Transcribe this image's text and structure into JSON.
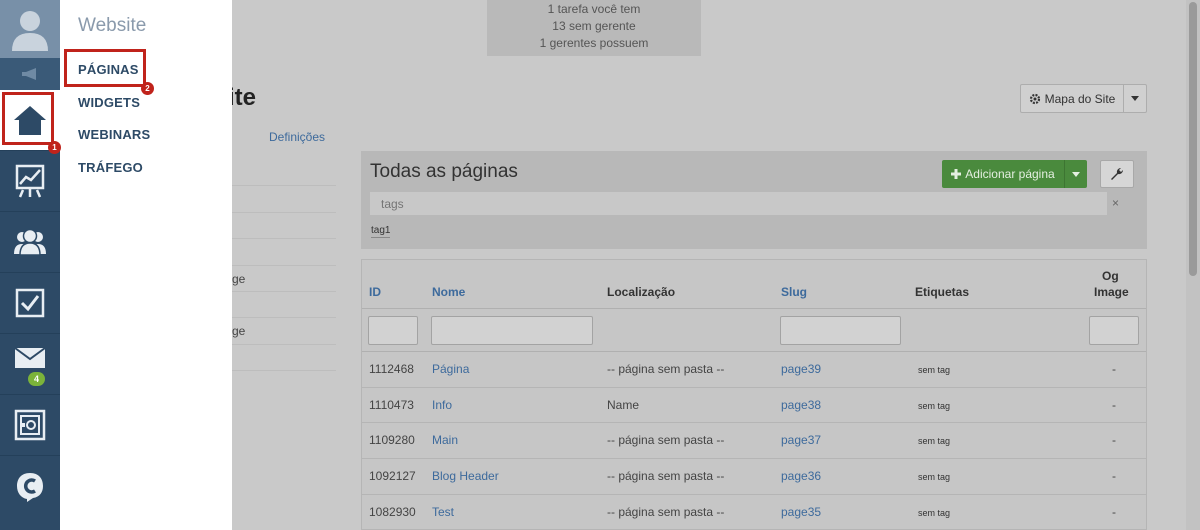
{
  "rail": {
    "badge_mail": "4",
    "annotation_1": "1",
    "annotation_2": "2"
  },
  "flyout": {
    "title": "Website",
    "items": [
      "PÁGINAS",
      "WIDGETS",
      "WEBINARS",
      "TRÁFEGO"
    ]
  },
  "notice": {
    "line1": "1 tarefa você tem",
    "line2": "13 sem gerente",
    "line3": "1 gerentes possuem"
  },
  "page": {
    "title_fragment": "ite",
    "tab_definitions": "Definições",
    "sitemap_label": "Mapa do Site"
  },
  "leftlist": [
    "",
    "",
    "",
    "",
    "ge",
    "",
    "ge",
    ""
  ],
  "panel": {
    "title": "Todas as páginas",
    "add_label": "Adicionar página",
    "tags_placeholder": "tags",
    "tags_clear": "×",
    "tag_chip": "tag1"
  },
  "table": {
    "headers": {
      "id": "ID",
      "name": "Nome",
      "location": "Localização",
      "slug": "Slug",
      "tags": "Etiquetas",
      "og1": "Og",
      "og2": "Image"
    },
    "rows": [
      {
        "id": "1112468",
        "name": "Página",
        "location": "-- página sem pasta --",
        "slug": "page39",
        "tags": "sem tag",
        "og": "-"
      },
      {
        "id": "1110473",
        "name": "Info",
        "location": "Name",
        "slug": "page38",
        "tags": "sem tag",
        "og": "-"
      },
      {
        "id": "1109280",
        "name": "Main",
        "location": "-- página sem pasta --",
        "slug": "page37",
        "tags": "sem tag",
        "og": "-"
      },
      {
        "id": "1092127",
        "name": "Blog Header",
        "location": "-- página sem pasta --",
        "slug": "page36",
        "tags": "sem tag",
        "og": "-"
      },
      {
        "id": "1082930",
        "name": "Test",
        "location": "-- página sem pasta --",
        "slug": "page35",
        "tags": "sem tag",
        "og": "-"
      }
    ]
  },
  "colors": {
    "rail_bg": "#2d4a66",
    "annotation_red": "#c0231b",
    "link_blue": "#3d6a9c",
    "add_green": "#4a8a3d",
    "badge_green": "#7bb33a"
  },
  "icons": [
    "user-icon",
    "megaphone-icon",
    "home-icon",
    "chart-icon",
    "contacts-icon",
    "checkbox-icon",
    "mail-icon",
    "safe-icon",
    "logo-icon",
    "gear-icon",
    "caret-down-icon",
    "plus-icon",
    "wrench-icon"
  ]
}
